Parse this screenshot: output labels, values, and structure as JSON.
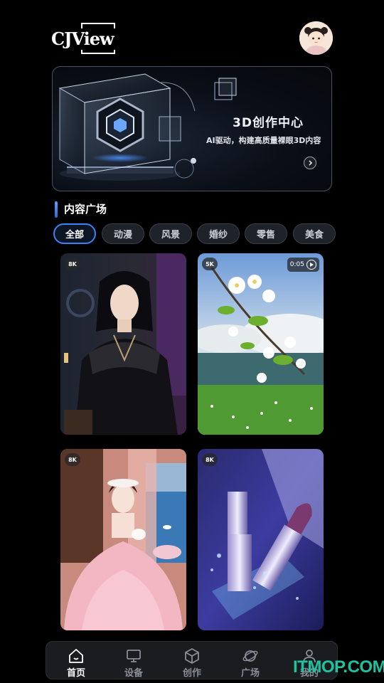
{
  "header": {
    "logo_text": "CJView"
  },
  "banner": {
    "title": "3D创作中心",
    "subtitle": "AI驱动，构建高质量裸眼3D内容"
  },
  "section": {
    "title": "内容广场"
  },
  "categories": [
    {
      "label": "全部",
      "active": true
    },
    {
      "label": "动漫",
      "active": false
    },
    {
      "label": "风景",
      "active": false
    },
    {
      "label": "婚纱",
      "active": false
    },
    {
      "label": "零售",
      "active": false
    },
    {
      "label": "美食",
      "active": false
    }
  ],
  "cards": [
    {
      "resolution": "8K",
      "subject": "costumed man portrait"
    },
    {
      "resolution": "5K",
      "duration": "0:05",
      "subject": "blossom branch by river"
    },
    {
      "resolution": "8K",
      "subject": "woman in pink ball gown"
    },
    {
      "resolution": "8K",
      "subject": "lipstick product shot"
    }
  ],
  "tabbar": [
    {
      "label": "首页",
      "icon": "home-icon",
      "active": true
    },
    {
      "label": "设备",
      "icon": "monitor-icon",
      "active": false
    },
    {
      "label": "创作",
      "icon": "cube-icon",
      "active": false
    },
    {
      "label": "广场",
      "icon": "planet-icon",
      "active": false
    },
    {
      "label": "我的",
      "icon": "user-icon",
      "active": false
    }
  ],
  "watermark": "ITMOP.COM",
  "colors": {
    "accent": "#3b82f6",
    "background": "#000000",
    "watermark": "#1cc3a0"
  }
}
